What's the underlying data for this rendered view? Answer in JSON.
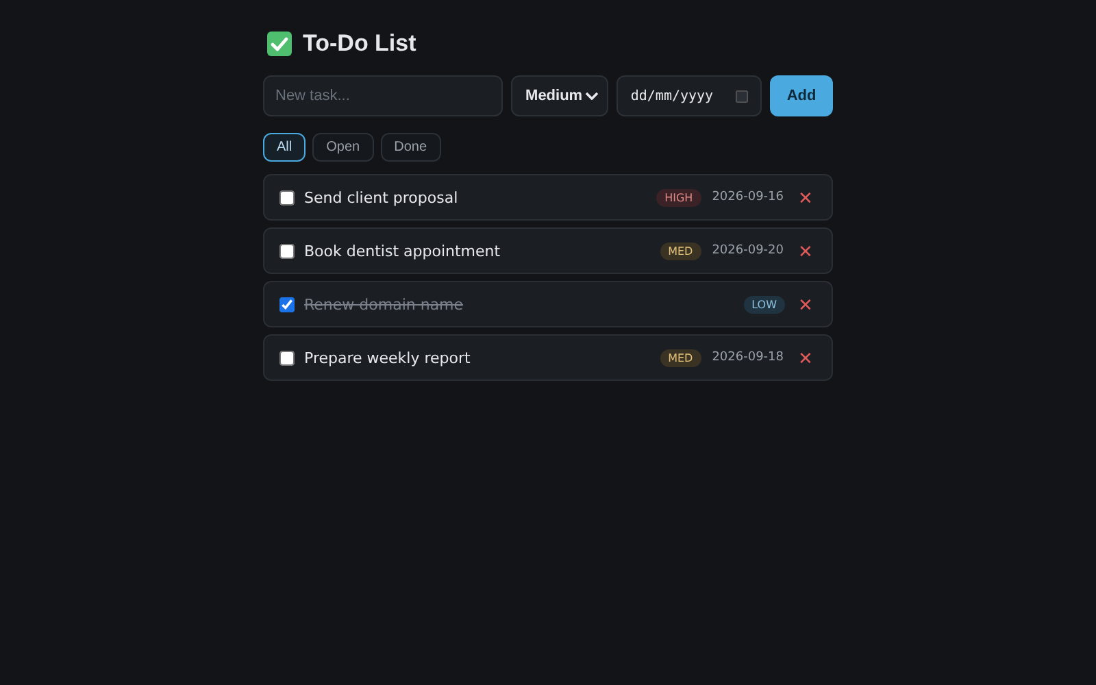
{
  "title": "To-Do List",
  "form": {
    "task": {
      "placeholder": "New task..."
    },
    "priority": "Medium",
    "date": {
      "placeholder": "dd/mm/yyyy"
    },
    "add_button": "Add"
  },
  "filters": [
    {
      "label": "All",
      "selected": true
    },
    {
      "label": "Open",
      "selected": false
    },
    {
      "label": "Done",
      "selected": false
    }
  ],
  "tasks": [
    {
      "text": "Send client proposal",
      "checked": false,
      "priority": "HIGH",
      "kind": "high",
      "date": "2026-09-16",
      "delete": "✕"
    },
    {
      "text": "Book dentist appointment",
      "checked": false,
      "priority": "MED",
      "kind": "med",
      "date": "2026-09-20",
      "delete": "✕"
    },
    {
      "text": "Renew domain name",
      "checked": true,
      "priority": "LOW",
      "kind": "low",
      "delete": "✕"
    },
    {
      "text": "Prepare weekly report",
      "checked": false,
      "priority": "MED",
      "kind": "med",
      "date": "2026-09-18",
      "delete": "✕"
    }
  ]
}
